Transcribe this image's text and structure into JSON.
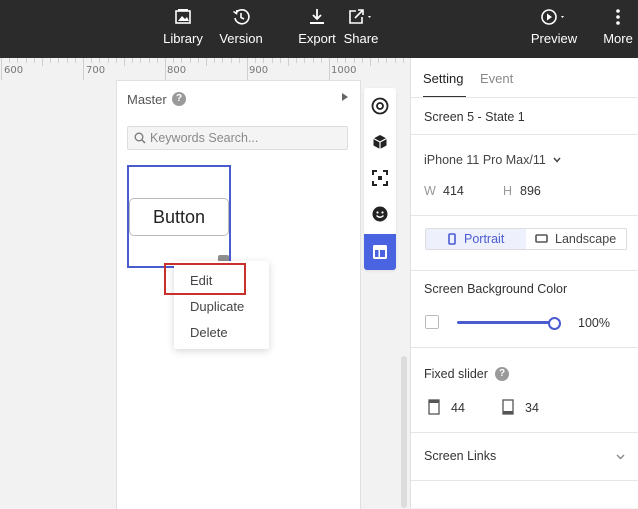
{
  "toolbar": {
    "library": "Library",
    "version": "Version",
    "export": "Export",
    "share": "Share",
    "preview": "Preview",
    "more": "More"
  },
  "ruler": {
    "labels": [
      "600",
      "700",
      "800",
      "900",
      "1000"
    ]
  },
  "master_panel": {
    "title": "Master",
    "search_placeholder": "Keywords Search...",
    "thumbnail_button_label": "Button"
  },
  "context_menu": {
    "items": [
      "Edit",
      "Duplicate",
      "Delete"
    ]
  },
  "side_tools": [
    "target-icon",
    "component-icon",
    "capture-icon",
    "emoji-icon",
    "layout-icon"
  ],
  "settings": {
    "tabs": [
      "Setting",
      "Event"
    ],
    "screen_name": "Screen 5 - State 1",
    "device": "iPhone 11 Pro Max/11",
    "width_label": "W",
    "width_value": "414",
    "height_label": "H",
    "height_value": "896",
    "orientation": {
      "portrait": "Portrait",
      "landscape": "Landscape"
    },
    "bg_color_label": "Screen Background Color",
    "bg_opacity": "100%",
    "fixed_slider_label": "Fixed slider",
    "fixed_top": "44",
    "fixed_bottom": "34",
    "screen_links_label": "Screen Links"
  },
  "colors": {
    "accent": "#4a5bd0",
    "toolbar_bg": "#2b2b2b",
    "highlight": "#c9302c"
  }
}
